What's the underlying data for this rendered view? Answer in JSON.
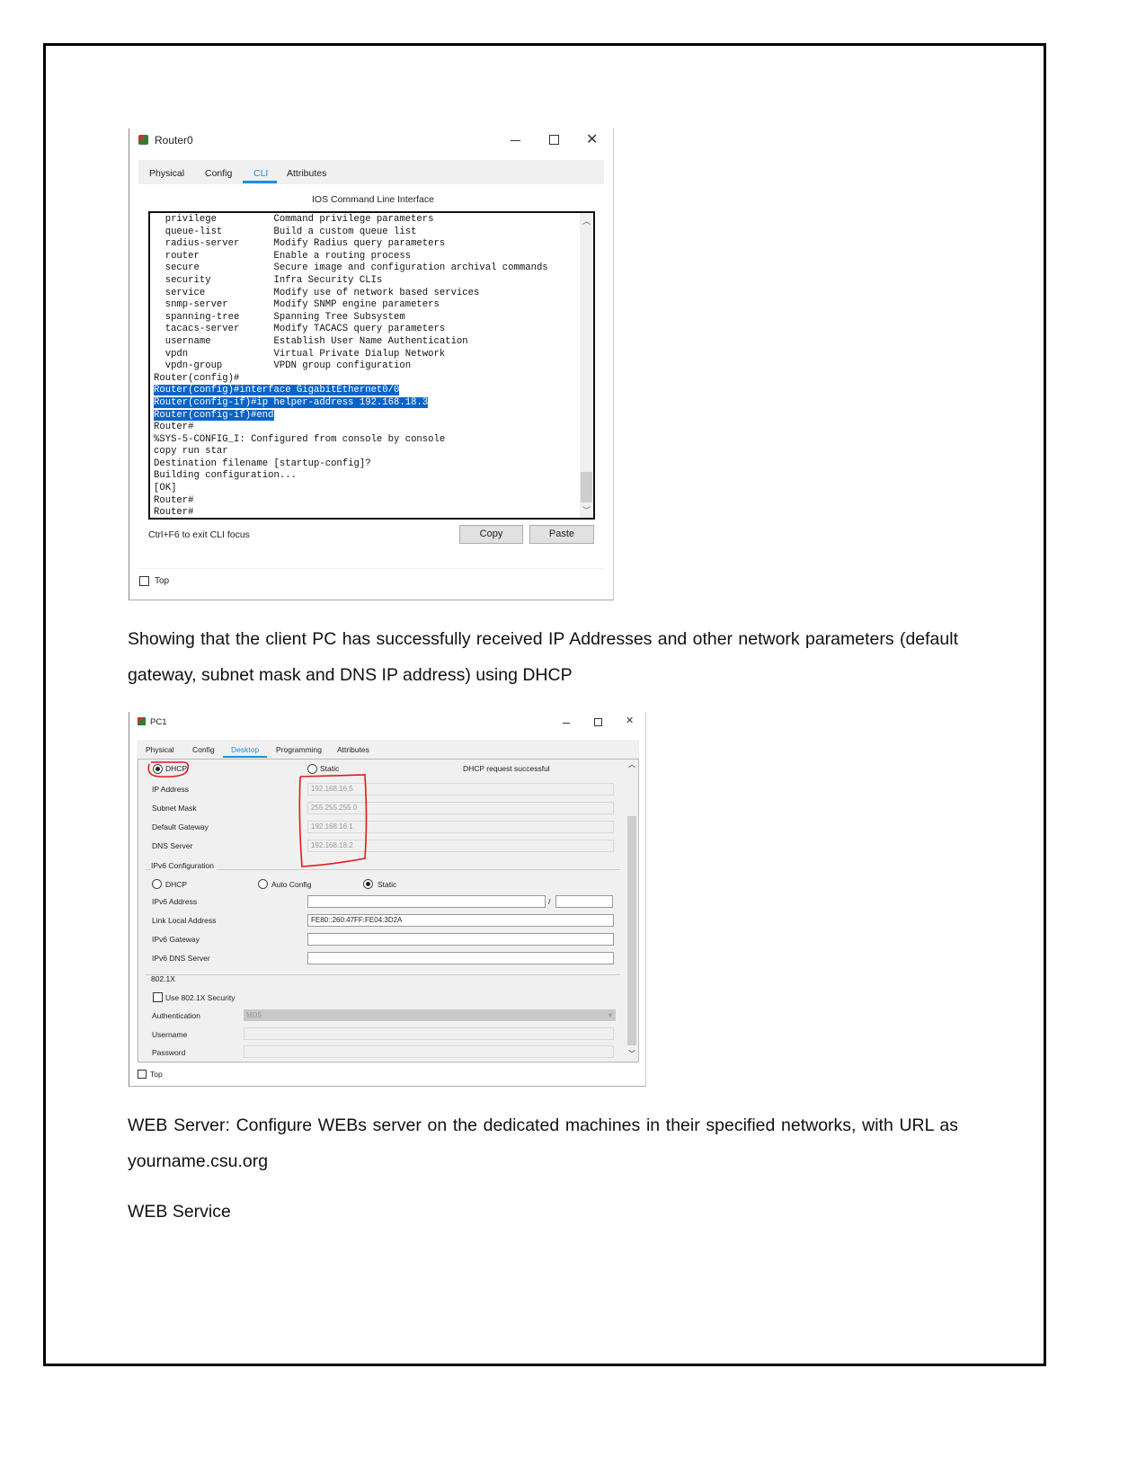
{
  "router_window": {
    "title": "Router0",
    "tabs": [
      "Physical",
      "Config",
      "CLI",
      "Attributes"
    ],
    "active_tab": "CLI",
    "section_title": "IOS Command Line Interface",
    "cli_lines": [
      "  privilege          Command privilege parameters",
      "  queue-list         Build a custom queue list",
      "  radius-server      Modify Radius query parameters",
      "  router             Enable a routing process",
      "  secure             Secure image and configuration archival commands",
      "  security           Infra Security CLIs",
      "  service            Modify use of network based services",
      "  snmp-server        Modify SNMP engine parameters",
      "  spanning-tree      Spanning Tree Subsystem",
      "  tacacs-server      Modify TACACS query parameters",
      "  username           Establish User Name Authentication",
      "  vpdn               Virtual Private Dialup Network",
      "  vpdn-group         VPDN group configuration",
      "Router(config)#"
    ],
    "cli_selected": [
      "Router(config)#interface GigabitEthernet0/0",
      "Router(config-if)#ip helper-address 192.168.18.3",
      "Router(config-if)#end"
    ],
    "cli_after": [
      "Router#",
      "%SYS-5-CONFIG_I: Configured from console by console",
      "copy run star",
      "Destination filename [startup-config]?",
      "Building configuration...",
      "[OK]",
      "Router#",
      "Router#"
    ],
    "hint": "Ctrl+F6 to exit CLI focus",
    "copy_label": "Copy",
    "paste_label": "Paste",
    "top_label": "Top",
    "accent": "#1e90d8"
  },
  "paragraph1": "Showing that the client PC has successfully received IP Addresses and other network parameters (default gateway, subnet mask and DNS IP address) using DHCP",
  "pc_window": {
    "title": "PC1",
    "tabs": [
      "Physical",
      "Config",
      "Desktop",
      "Programming",
      "Attributes"
    ],
    "active_tab": "Desktop",
    "dhcp_label": "DHCP",
    "static_label": "Static",
    "status": "DHCP request successful",
    "fields": [
      {
        "label": "IP Address",
        "value": "192.168.16.5"
      },
      {
        "label": "Subnet Mask",
        "value": "255.255.255.0"
      },
      {
        "label": "Default Gateway",
        "value": "192.168.16.1"
      },
      {
        "label": "DNS Server",
        "value": "192.168.18.2"
      }
    ],
    "ipv6": {
      "title": "IPv6 Configuration",
      "modes": [
        "DHCP",
        "Auto Config",
        "Static"
      ],
      "selected_mode": "Static",
      "fields": [
        {
          "label": "IPv6 Address",
          "value": ""
        },
        {
          "label": "Link Local Address",
          "value": "FE80::260:47FF:FE04:3D2A"
        },
        {
          "label": "IPv6 Gateway",
          "value": ""
        },
        {
          "label": "IPv6 DNS Server",
          "value": ""
        }
      ],
      "prefix_sep": "/"
    },
    "dot1x": {
      "title": "802.1X",
      "use_label": "Use 802.1X Security",
      "auth_label": "Authentication",
      "auth_value": "MD5",
      "username_label": "Username",
      "password_label": "Password"
    },
    "top_label": "Top",
    "annotation_color": "#e0191e"
  },
  "paragraph2": "WEB Server: Configure WEBs server on the dedicated machines in their specified networks, with URL as yourname.csu.org",
  "paragraph3": "WEB Service"
}
